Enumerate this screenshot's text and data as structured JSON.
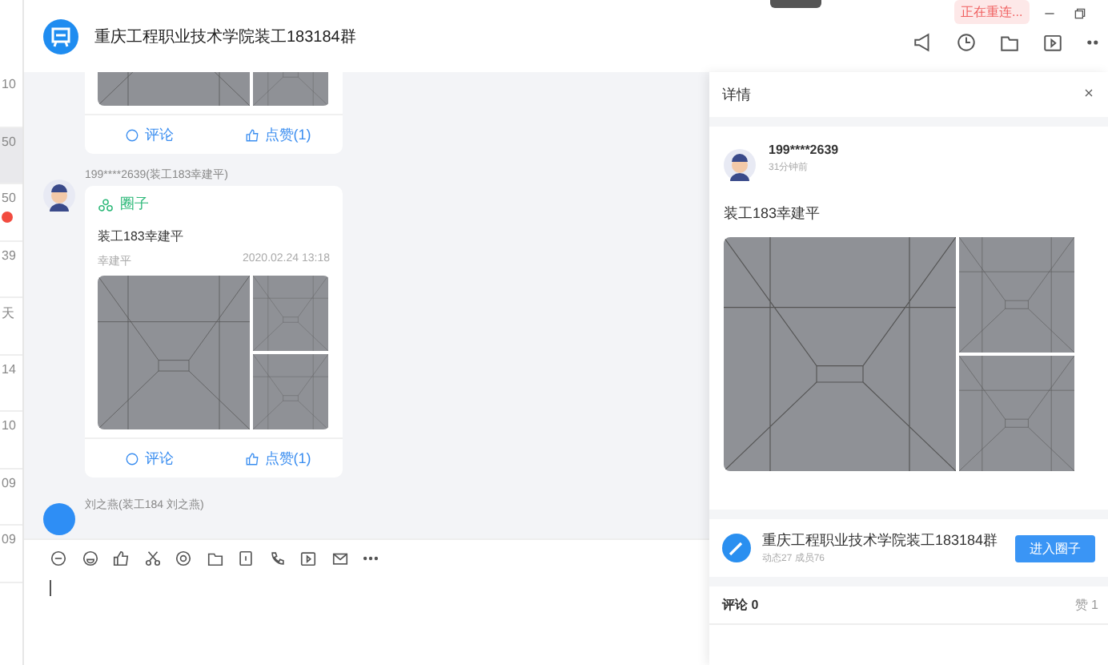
{
  "top_bar": {
    "status_badge": "正在重连..."
  },
  "conversation_list": [
    {
      "time": "10",
      "selected": false,
      "unread": false
    },
    {
      "time": "50",
      "selected": true,
      "unread": false
    },
    {
      "time": "50",
      "selected": false,
      "unread": true
    },
    {
      "time": "39",
      "selected": false,
      "unread": false
    },
    {
      "time": "天",
      "selected": false,
      "unread": false
    },
    {
      "time": "14",
      "selected": false,
      "unread": false
    },
    {
      "time": "10",
      "selected": false,
      "unread": false
    },
    {
      "time": "09",
      "selected": false,
      "unread": false
    },
    {
      "time": "09",
      "selected": false,
      "unread": false
    }
  ],
  "chat": {
    "title": "重庆工程职业技术学院装工183184群",
    "messages": [
      {
        "kind": "post-partial",
        "comment_label": "评论",
        "like_label": "点赞(1)"
      },
      {
        "kind": "post",
        "sender": "199****2639(装工183幸建平)",
        "tag": "圈子",
        "title": "装工183幸建平",
        "author": "幸建平",
        "date": "2020.02.24 13:18",
        "comment_label": "评论",
        "like_label": "点赞(1)"
      },
      {
        "kind": "name-only",
        "sender": "刘之燕(装工184 刘之燕)"
      }
    ]
  },
  "detail": {
    "title": "详情",
    "user": "199****2639",
    "time": "31分钟前",
    "text": "装工183幸建平",
    "group": {
      "name": "重庆工程职业技术学院装工183184群",
      "stats": "动态27 成员76",
      "button": "进入圈子"
    },
    "comments_label": "评论 0",
    "likes_label": "赞 1"
  }
}
